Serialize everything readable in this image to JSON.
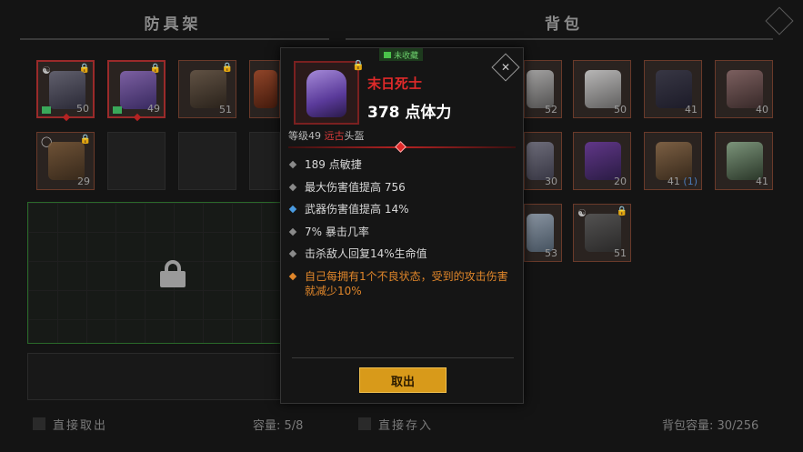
{
  "left_panel": {
    "title": "防具架",
    "bottom_action": "直接取出",
    "capacity": "容量: 5/8"
  },
  "right_panel": {
    "title": "背包",
    "bottom_action": "直接存入",
    "capacity": "背包容量: 30/256"
  },
  "left_slots": [
    {
      "level": "50"
    },
    {
      "level": "49"
    },
    {
      "level": "51"
    },
    {
      "level": "29"
    }
  ],
  "right_slots": [
    {
      "level": "52"
    },
    {
      "level": "50"
    },
    {
      "level": "41"
    },
    {
      "level": "40"
    },
    {
      "level": "30"
    },
    {
      "level": "20"
    },
    {
      "level": "41",
      "extra": "(1)"
    },
    {
      "level": "41"
    },
    {
      "level": "53"
    },
    {
      "level": "51"
    }
  ],
  "tooltip": {
    "badge": "未收藏",
    "item_name": "末日死士",
    "main_stat": "378 点体力",
    "level_prefix": "等级49",
    "quality": "远古",
    "item_type": "头盔",
    "stats": [
      "189 点敏捷",
      "最大伤害值提高 756",
      "武器伤害值提高 14%",
      "7% 暴击几率",
      "击杀敌人回复14%生命值"
    ],
    "special": "自己每拥有1个不良状态，受到的攻击伤害就减少10%",
    "take_button": "取出"
  },
  "colors": {
    "legendary_red": "#e02a2a",
    "special_orange": "#e0862a",
    "button_gold": "#d89a1a",
    "uncollected_green": "#6ccf6c"
  }
}
